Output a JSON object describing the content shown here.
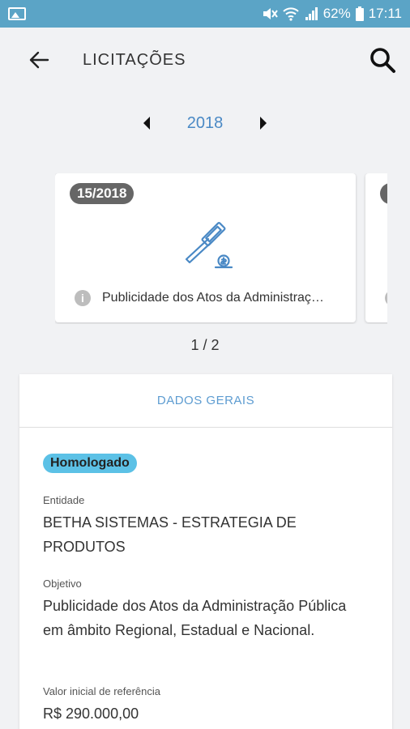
{
  "status_bar": {
    "battery": "62%",
    "time": "17:11"
  },
  "header": {
    "title": "LICITAÇÕES"
  },
  "year_selector": {
    "year": "2018"
  },
  "cards": [
    {
      "badge": "15/2018",
      "description": "Publicidade dos Atos da Administraç…"
    }
  ],
  "pager": "1 / 2",
  "details": {
    "tab_label": "DADOS GERAIS",
    "status": "Homologado",
    "entidade_label": "Entidade",
    "entidade_value": "BETHA SISTEMAS - ESTRATEGIA DE PRODUTOS",
    "objetivo_label": "Objetivo",
    "objetivo_value": "Publicidade dos Atos da Administração Pública em âmbito Regional, Estadual e Nacional.",
    "valor_label": "Valor inicial de referência",
    "valor_value": "R$ 290.000,00"
  },
  "colors": {
    "status_bar": "#5ba4c6",
    "accent_blue": "#4a89c5",
    "status_pill": "#5cc1e6",
    "badge": "#666666"
  },
  "icons": [
    "image-icon",
    "mute-icon",
    "wifi-icon",
    "signal-icon",
    "battery-icon",
    "back-arrow-icon",
    "search-icon",
    "chevron-left-icon",
    "chevron-right-icon",
    "gavel-icon",
    "info-icon"
  ]
}
